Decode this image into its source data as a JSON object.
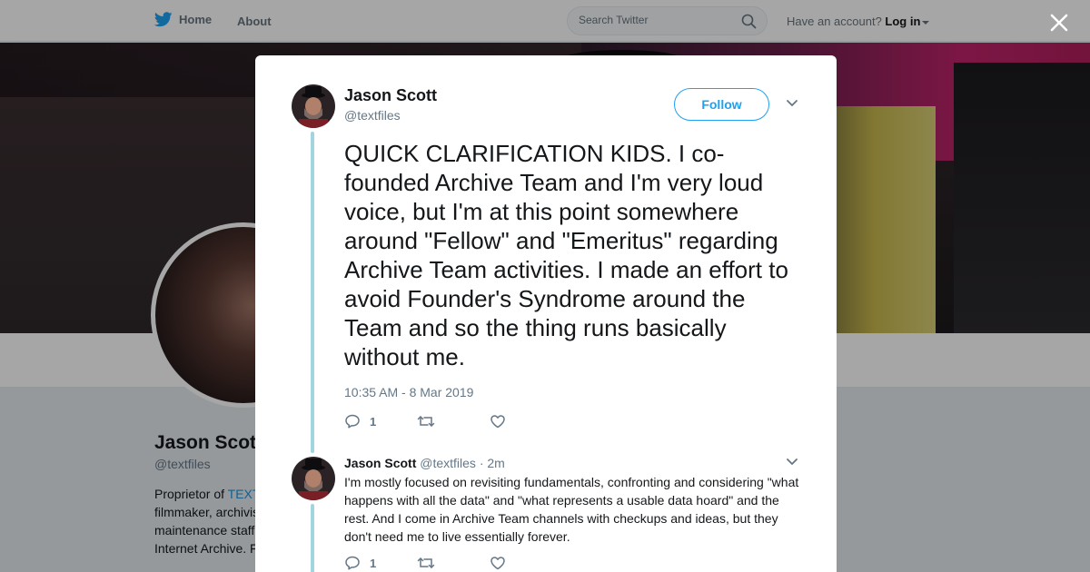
{
  "nav": {
    "home_label": "Home",
    "about_label": "About",
    "search_placeholder": "Search Twitter",
    "account_prompt": "Have an account?",
    "login_label": "Log in"
  },
  "profile": {
    "name": "Jason Scott",
    "handle": "@textfiles",
    "bio_lines": [
      {
        "pre": "Proprietor of ",
        "link": "TEXT"
      },
      {
        "pre": "filmmaker, archivis",
        "link": ""
      },
      {
        "pre": "maintenance staff",
        "link": ""
      },
      {
        "pre": "Internet Archive. F",
        "link": ""
      }
    ]
  },
  "tweet": {
    "author_name": "Jason Scott",
    "author_handle": "@textfiles",
    "follow_label": "Follow",
    "text": "QUICK CLARIFICATION KIDS. I co-founded Archive Team and I'm very loud voice, but I'm at this point somewhere around \"Fellow\" and \"Emeritus\" regarding Archive Team activities. I made an effort to avoid Founder's Syndrome around the Team and so the thing runs basically without me.",
    "timestamp": "10:35 AM - 8 Mar 2019",
    "reply_count": "1"
  },
  "reply": {
    "author_name": "Jason Scott",
    "author_handle": "@textfiles",
    "time": "· 2m",
    "text": "I'm mostly focused on revisiting fundamentals, confronting and considering \"what happens with all the data\" and \"what represents a usable data hoard\" and the rest. And I come in Archive Team channels with checkups and ideas, but they don't need me to live essentially forever.",
    "reply_count": "1"
  },
  "colors": {
    "twitter_blue": "#1da1f2",
    "thread_line": "#a3d5e0",
    "secondary_text": "#657786"
  },
  "icons": [
    "twitter-bird-icon",
    "search-icon",
    "close-icon",
    "chevron-down-icon",
    "reply-icon",
    "retweet-icon",
    "like-icon"
  ]
}
